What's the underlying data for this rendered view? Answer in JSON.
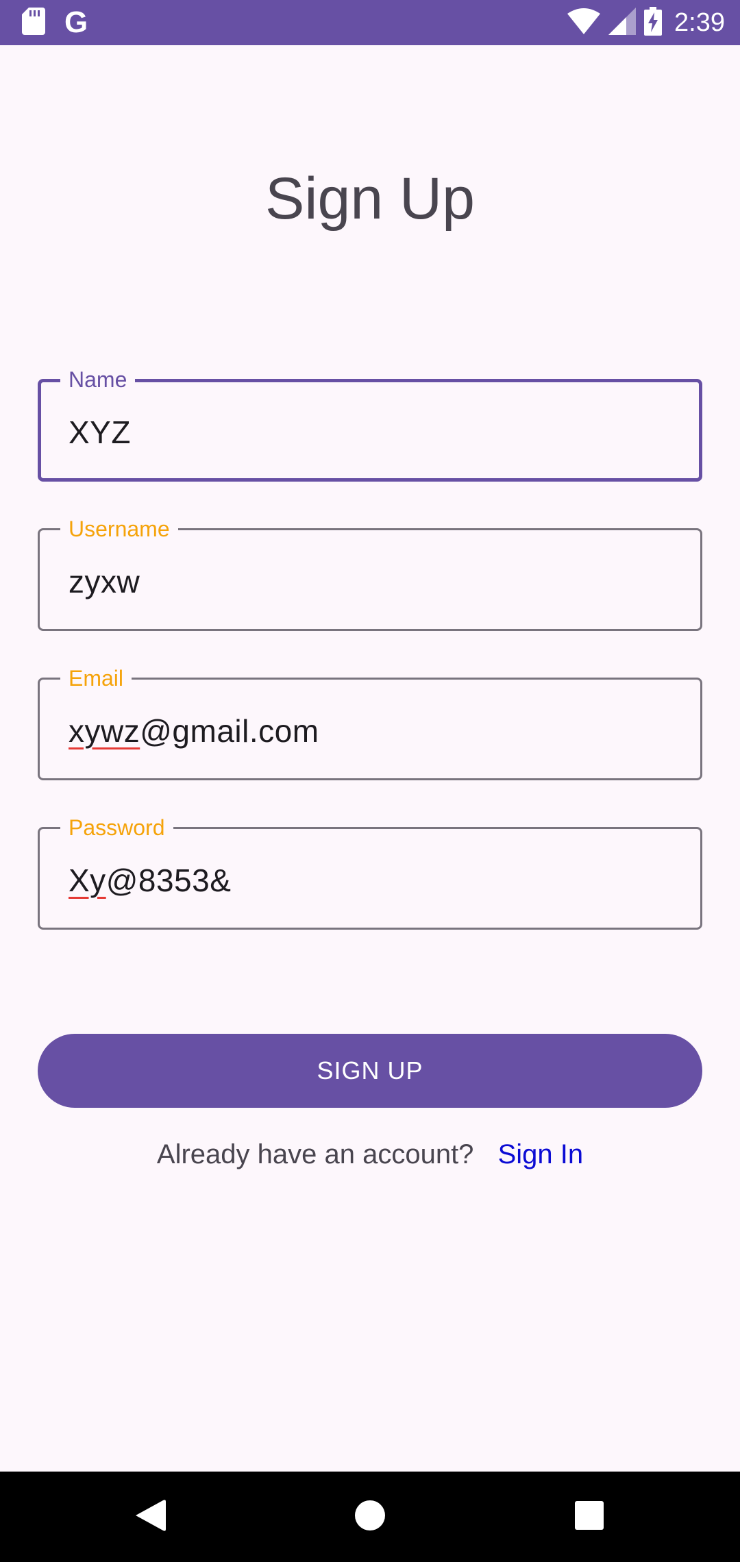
{
  "status_bar": {
    "time": "2:39",
    "left_icons": [
      "sd-card-icon",
      "google-icon"
    ],
    "google_glyph": "G",
    "right_icons": [
      "wifi-icon",
      "signal-icon",
      "battery-charging-icon"
    ]
  },
  "title": "Sign Up",
  "form": {
    "name": {
      "label": "Name",
      "value": "XYZ"
    },
    "username": {
      "label": "Username",
      "value": "zyxw"
    },
    "email": {
      "label": "Email",
      "value_misspelled": "xywz",
      "value_rest": "@gmail.com"
    },
    "password": {
      "label": "Password",
      "value_misspelled": "Xy",
      "value_rest": "@8353&"
    }
  },
  "signup_button": {
    "label": "SIGN UP"
  },
  "signin": {
    "prompt": "Already have an account?",
    "link": "Sign In"
  },
  "nav_bar": {
    "icons": [
      "back-icon",
      "home-icon",
      "recents-icon"
    ]
  },
  "colors": {
    "primary": "#6750a4",
    "label_accent": "#f5a30a",
    "link": "#0b0bd4",
    "background": "#fdf7fc",
    "spellcheck": "#e53935"
  }
}
